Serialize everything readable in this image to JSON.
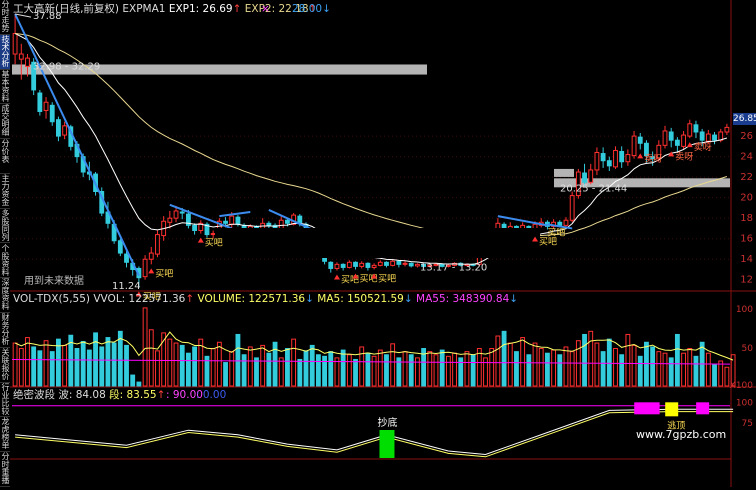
{
  "sidebar": {
    "tabs": [
      "分时走势",
      "技术分析",
      "基本资料",
      "成交明细",
      "分价表",
      "主力资金",
      "多股同列",
      "个股资料",
      "深度资料",
      "财务分析",
      "关联报价",
      "行业比较",
      "龙虎榜单",
      "分时重播"
    ],
    "selected": 1
  },
  "main_header": {
    "title": "工大高新(日线,前复权)",
    "indicator": "EXPMA1",
    "exp1_label": "EXP1: 26.69",
    "exp2_label": "EXP2: 22.18",
    "exp1_arrow": "↑",
    "exp2_arrow": "↑",
    "mark": "×",
    "price_marker": "28.00",
    "price_marker_arrow": "↓"
  },
  "vol_header": {
    "title": "VOL-TDX(5,55)",
    "vvol": "VVOL: 122571.36",
    "vvol_arrow": "↑",
    "volume": "VOLUME: 122571.36",
    "volume_arrow": "↓",
    "ma5": "MA5: 150521.59",
    "ma5_arrow": "↓",
    "ma55": "MA55: 348390.84",
    "ma55_arrow": "↓"
  },
  "ind_header": {
    "title": "绝密波段",
    "bo": "波: 84.08",
    "duan": "段: 83.55",
    "duan_arrow": "↑",
    "v90": ": 90.00",
    "v0": ": 0.00"
  },
  "annotations": {
    "high_price": "37.88",
    "zone_top": "32.98 - 32.29",
    "zone_mid": "20.25 - 21.44",
    "low_price": "11.24",
    "low_zone": "13.17 - 13.20",
    "future_note": "用到未来数据",
    "buy_label": "买吧",
    "sell_label": "卖呀",
    "buy_tag": "买吧",
    "bottom_label": "抄底",
    "top_label": "逃顶",
    "current_price": "26.85",
    "watermark": "www.7gpzb.com"
  },
  "axes": {
    "price_ticks": [
      "26",
      "24",
      "22",
      "20",
      "18",
      "16",
      "14",
      "12"
    ],
    "vol_ticks": [
      "100",
      "50",
      "X100"
    ],
    "ind_ticks": [
      "100",
      "75"
    ]
  },
  "colors": {
    "up": "#ff3030",
    "down": "#33ccdd",
    "ema_fast": "#ffffff",
    "ema_slow": "#e8d890",
    "trend": "#3c8cf0",
    "zone": "#b4b4b4",
    "ma55": "#ff00ff",
    "ma5": "#ffff66",
    "magenta_box": "#ff00ff",
    "yellow_box": "#ffff00",
    "green_box": "#00dd00"
  },
  "chart_data": {
    "type": "candlestick",
    "candles": [
      [
        34,
        36,
        33,
        37.9
      ],
      [
        33.5,
        34,
        31.5,
        35
      ],
      [
        32.8,
        33.6,
        31.8,
        34
      ],
      [
        33.2,
        30.5,
        30,
        33.6
      ],
      [
        30.2,
        28.4,
        28,
        30.5
      ],
      [
        28.5,
        29.3,
        27.7,
        29.8
      ],
      [
        29,
        27.4,
        27,
        29.3
      ],
      [
        27.6,
        26,
        25.5,
        27.9
      ],
      [
        26.1,
        27,
        25.7,
        27.4
      ],
      [
        26.9,
        25,
        24.6,
        27.1
      ],
      [
        25.2,
        24,
        23.4,
        25.5
      ],
      [
        24,
        22.5,
        22,
        24.3
      ],
      [
        22.5,
        22.3,
        21.7,
        23.5
      ],
      [
        22.3,
        20.6,
        20.2,
        22.5
      ],
      [
        20.6,
        18.5,
        18.2,
        21
      ],
      [
        18.6,
        17.5,
        17,
        19.6
      ],
      [
        17.4,
        15.8,
        15.5,
        17.8
      ],
      [
        15.8,
        14.6,
        14.3,
        16
      ],
      [
        14.5,
        13.7,
        13.2,
        14.8
      ],
      [
        13.6,
        13,
        12.4,
        14
      ],
      [
        13.1,
        12.2,
        11.24,
        13.3
      ],
      [
        12.3,
        14,
        12,
        14.4
      ],
      [
        14,
        14.6,
        13.5,
        15.2
      ],
      [
        14.5,
        16.4,
        14.2,
        16.8
      ],
      [
        16.3,
        17.7,
        15.8,
        18.2
      ],
      [
        17.6,
        18,
        17,
        18.7
      ],
      [
        18,
        18.7,
        17.6,
        19.2
      ],
      [
        18.6,
        18.5,
        17.9,
        19
      ],
      [
        18.4,
        17.3,
        17,
        18.8
      ],
      [
        17.3,
        16.8,
        16.4,
        17.5
      ],
      [
        16.8,
        17.5,
        16.5,
        17.8
      ],
      [
        17.4,
        16.4,
        16.1,
        17.6
      ],
      [
        16.5,
        16.5,
        16,
        16.8
      ],
      [
        16.5,
        17.7,
        16.3,
        18
      ],
      [
        17.7,
        17.5,
        17.1,
        18.1
      ],
      [
        17.4,
        18.2,
        17,
        18.6
      ],
      [
        18.1,
        17.4,
        17.2,
        18.3
      ],
      [
        17.3,
        16.6,
        16.3,
        17.5
      ],
      [
        16.6,
        17.2,
        16.2,
        17.4
      ],
      [
        17.2,
        16.7,
        16.4,
        17.3
      ],
      [
        16.7,
        17.5,
        16.6,
        18
      ],
      [
        17.5,
        17.3,
        17,
        17.7
      ],
      [
        17.3,
        17,
        16.7,
        17.5
      ],
      [
        17,
        17.8,
        16.9,
        18.3
      ],
      [
        17.8,
        17.5,
        17.2,
        18
      ],
      [
        17.4,
        18.3,
        17.3,
        18.5
      ],
      [
        18.2,
        17.5,
        17.2,
        18.4
      ],
      [
        17.4,
        17,
        16.8,
        17.6
      ],
      [
        16.9,
        16,
        15.5,
        17
      ],
      [
        15.9,
        14.8,
        14.6,
        16
      ],
      [
        14.8,
        13.8,
        13.5,
        15
      ],
      [
        13.7,
        13.1,
        12.7,
        13.8
      ],
      [
        13.1,
        13.5,
        12.9,
        13.7
      ],
      [
        13.5,
        13.2,
        12.9,
        13.6
      ],
      [
        13.2,
        13.7,
        13.1,
        13.9
      ],
      [
        13.7,
        13.3,
        13,
        13.8
      ],
      [
        13.3,
        13.6,
        13.1,
        13.8
      ],
      [
        13.6,
        13.2,
        12.9,
        13.7
      ],
      [
        13.2,
        13.4,
        13,
        13.6
      ],
      [
        13.4,
        13.7,
        13.3,
        13.9
      ],
      [
        13.7,
        13.4,
        13.2,
        13.8
      ],
      [
        13.4,
        13.8,
        13.3,
        14
      ],
      [
        13.8,
        13.5,
        13.2,
        13.9
      ],
      [
        13.5,
        13.6,
        13.3,
        13.8
      ],
      [
        13.6,
        13.35,
        13.2,
        13.7
      ],
      [
        13.35,
        13.5,
        13.2,
        13.6
      ],
      [
        13.5,
        13.3,
        13.17,
        13.6
      ],
      [
        13.3,
        13.4,
        13.2,
        13.5
      ],
      [
        13.4,
        13.5,
        13.3,
        13.6
      ],
      [
        13.5,
        13.3,
        13.2,
        13.6
      ],
      [
        13.3,
        13.4,
        13.2,
        13.5
      ],
      [
        13.4,
        13.6,
        13.3,
        13.7
      ],
      [
        13.6,
        13.4,
        13.3,
        13.7
      ],
      [
        13.4,
        13.5,
        13.3,
        13.6
      ],
      [
        13.5,
        13.45,
        13.3,
        13.6
      ],
      [
        13.5,
        14.5,
        13.3,
        14.8
      ],
      [
        14.4,
        15.6,
        14.2,
        16
      ],
      [
        15.5,
        16.6,
        15.3,
        17
      ],
      [
        16.5,
        17.5,
        16.2,
        18
      ],
      [
        17.4,
        16.8,
        16.5,
        17.6
      ],
      [
        16.8,
        17.2,
        16.4,
        17.6
      ],
      [
        17.2,
        16.9,
        16.5,
        17.3
      ],
      [
        16.9,
        17.3,
        16.6,
        17.6
      ],
      [
        17.2,
        16.8,
        16.4,
        17.3
      ],
      [
        16.8,
        17.4,
        16.6,
        17.7
      ],
      [
        17.3,
        17.6,
        17.1,
        18
      ],
      [
        17.6,
        17.2,
        16.9,
        17.8
      ],
      [
        17.2,
        17.6,
        17,
        17.9
      ],
      [
        17.6,
        17.3,
        17.1,
        17.8
      ],
      [
        17.3,
        17.8,
        17.2,
        18.1
      ],
      [
        17.8,
        20.2,
        17.6,
        20.6
      ],
      [
        20.2,
        22.5,
        19.9,
        22.8
      ],
      [
        22.4,
        21.5,
        21.1,
        23.3
      ],
      [
        21.5,
        22.7,
        21.3,
        23.3
      ],
      [
        22.7,
        24.4,
        22.2,
        24.9
      ],
      [
        24.3,
        23.6,
        22.9,
        24.9
      ],
      [
        23.6,
        23.1,
        22.6,
        24
      ],
      [
        23,
        24.6,
        22.8,
        25
      ],
      [
        24.5,
        23.5,
        22.9,
        25
      ],
      [
        23.5,
        24.2,
        23.1,
        24.7
      ],
      [
        24.1,
        26,
        23.8,
        26.5
      ],
      [
        25.9,
        25.3,
        24.7,
        26.3
      ],
      [
        25.3,
        24.1,
        23.4,
        25.6
      ],
      [
        24,
        23.8,
        23.1,
        24.5
      ],
      [
        23.8,
        25.1,
        23.5,
        25.6
      ],
      [
        25.1,
        26.5,
        24.8,
        27
      ],
      [
        26.4,
        25.6,
        24.9,
        26.8
      ],
      [
        25.6,
        25.1,
        24.5,
        25.9
      ],
      [
        25,
        26.1,
        24.7,
        26.5
      ],
      [
        26,
        27.2,
        25.8,
        27.6
      ],
      [
        27.1,
        26.4,
        25.8,
        27.5
      ],
      [
        26.4,
        25.6,
        25,
        26.7
      ],
      [
        25.5,
        26.2,
        25.2,
        26.6
      ],
      [
        26.1,
        25.6,
        25.2,
        26.4
      ],
      [
        25.6,
        26.4,
        25.4,
        26.7
      ],
      [
        26.4,
        26.85,
        26.1,
        27.2
      ]
    ],
    "volumes": [
      55,
      48,
      62,
      50,
      45,
      58,
      44,
      60,
      52,
      65,
      48,
      57,
      46,
      68,
      50,
      62,
      55,
      70,
      52,
      14,
      5,
      100,
      72,
      45,
      68,
      60,
      55,
      52,
      42,
      50,
      60,
      38,
      48,
      56,
      30,
      44,
      66,
      40,
      50,
      36,
      52,
      42,
      56,
      36,
      48,
      60,
      34,
      45,
      52,
      40,
      38,
      44,
      36,
      46,
      40,
      34,
      50,
      42,
      38,
      46,
      40,
      54,
      36,
      44,
      40,
      36,
      48,
      44,
      40,
      46,
      38,
      42,
      36,
      44,
      40,
      48,
      36,
      48,
      64,
      70,
      55,
      44,
      62,
      40,
      55,
      48,
      42,
      46,
      40,
      50,
      44,
      58,
      66,
      70,
      55,
      44,
      60,
      48,
      40,
      66,
      52,
      38,
      56,
      50,
      44,
      42,
      36,
      66,
      42,
      48,
      38,
      56,
      42,
      28,
      32,
      24,
      40
    ],
    "ma55_level": 30,
    "y_range_price": [
      11,
      37.9
    ],
    "buy_signal_indices": [
      20,
      22,
      30,
      52,
      55,
      58,
      84
    ],
    "sell_signal_indices": [
      101,
      106,
      109
    ],
    "osc_peaks": [
      [
        0,
        40
      ],
      [
        10,
        30
      ],
      [
        18,
        22
      ],
      [
        28,
        48
      ],
      [
        36,
        40
      ],
      [
        44,
        24
      ],
      [
        52,
        14
      ],
      [
        60,
        40
      ],
      [
        70,
        12
      ],
      [
        76,
        6
      ],
      [
        86,
        44
      ],
      [
        96,
        82
      ],
      [
        106,
        84
      ],
      [
        116,
        84
      ]
    ]
  }
}
